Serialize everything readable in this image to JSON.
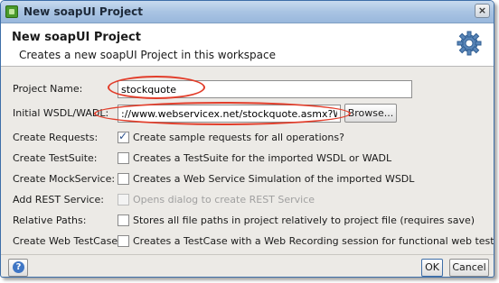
{
  "window": {
    "title": "New soapUI Project",
    "close_glyph": "×",
    "icon": "soapui-app-icon"
  },
  "header": {
    "title": "New soapUI Project",
    "description": "Creates a new soapUI Project in this workspace",
    "icon": "gear-icon"
  },
  "fields": {
    "project_name": {
      "label": "Project Name:",
      "value": "stockquote"
    },
    "wsdl": {
      "label": "Initial WSDL/WADL:",
      "value": "://www.webservicex.net/stockquote.asmx?WSDL",
      "browse_label": "Browse..."
    }
  },
  "options": [
    {
      "label": "Create Requests:",
      "text": "Create sample requests for all operations?",
      "checked": true,
      "enabled": true
    },
    {
      "label": "Create TestSuite:",
      "text": "Creates a TestSuite for the imported WSDL or WADL",
      "checked": false,
      "enabled": true
    },
    {
      "label": "Create MockService:",
      "text": "Creates a Web Service Simulation of the imported WSDL",
      "checked": false,
      "enabled": true
    },
    {
      "label": "Add REST Service:",
      "text": "Opens dialog to create REST Service",
      "checked": false,
      "enabled": false
    },
    {
      "label": "Relative Paths:",
      "text": "Stores all file paths in project relatively to project file (requires save)",
      "checked": false,
      "enabled": true
    },
    {
      "label": "Create Web TestCase:",
      "text": "Creates a TestCase with a Web Recording session for functional web testing",
      "checked": false,
      "enabled": true
    }
  ],
  "footer": {
    "help_glyph": "?",
    "ok_label": "OK",
    "cancel_label": "Cancel"
  },
  "annotation_color": "#e23d2a"
}
